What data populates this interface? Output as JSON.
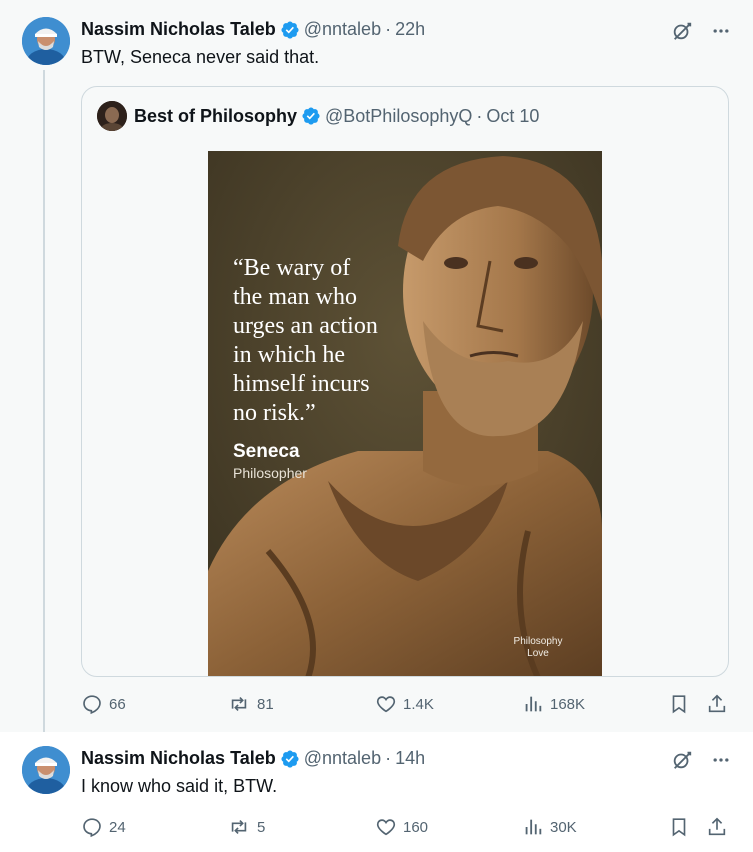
{
  "tweet1": {
    "author_name": "Nassim Nicholas Taleb",
    "handle": "@nntaleb",
    "time": "22h",
    "text": "BTW, Seneca never said that.",
    "quote": {
      "author_name": "Best of Philosophy",
      "handle": "@BotPhilosophyQ",
      "time": "Oct 10",
      "image": {
        "quote": "“Be wary of\nthe man who\nurges an action\nin which he\nhimself incurs\nno risk.”",
        "author": "Seneca",
        "author_title": "Philosopher",
        "watermark": "Philosophy\nLove"
      }
    },
    "actions": {
      "replies": "66",
      "reposts": "81",
      "likes": "1.4K",
      "views": "168K"
    }
  },
  "tweet2": {
    "author_name": "Nassim Nicholas Taleb",
    "handle": "@nntaleb",
    "time": "14h",
    "text": "I know who said it, BTW.",
    "actions": {
      "replies": "24",
      "reposts": "5",
      "likes": "160",
      "views": "30K"
    }
  },
  "separator": "·",
  "colors": {
    "verified": "#1d9bf0",
    "secondary": "#536471",
    "border": "#cfd9de",
    "thread_bg": "#f7f9f9"
  },
  "icons": [
    "grok-icon",
    "more-icon",
    "reply-icon",
    "repost-icon",
    "like-icon",
    "views-icon",
    "bookmark-icon",
    "share-icon",
    "verified-badge-icon"
  ]
}
